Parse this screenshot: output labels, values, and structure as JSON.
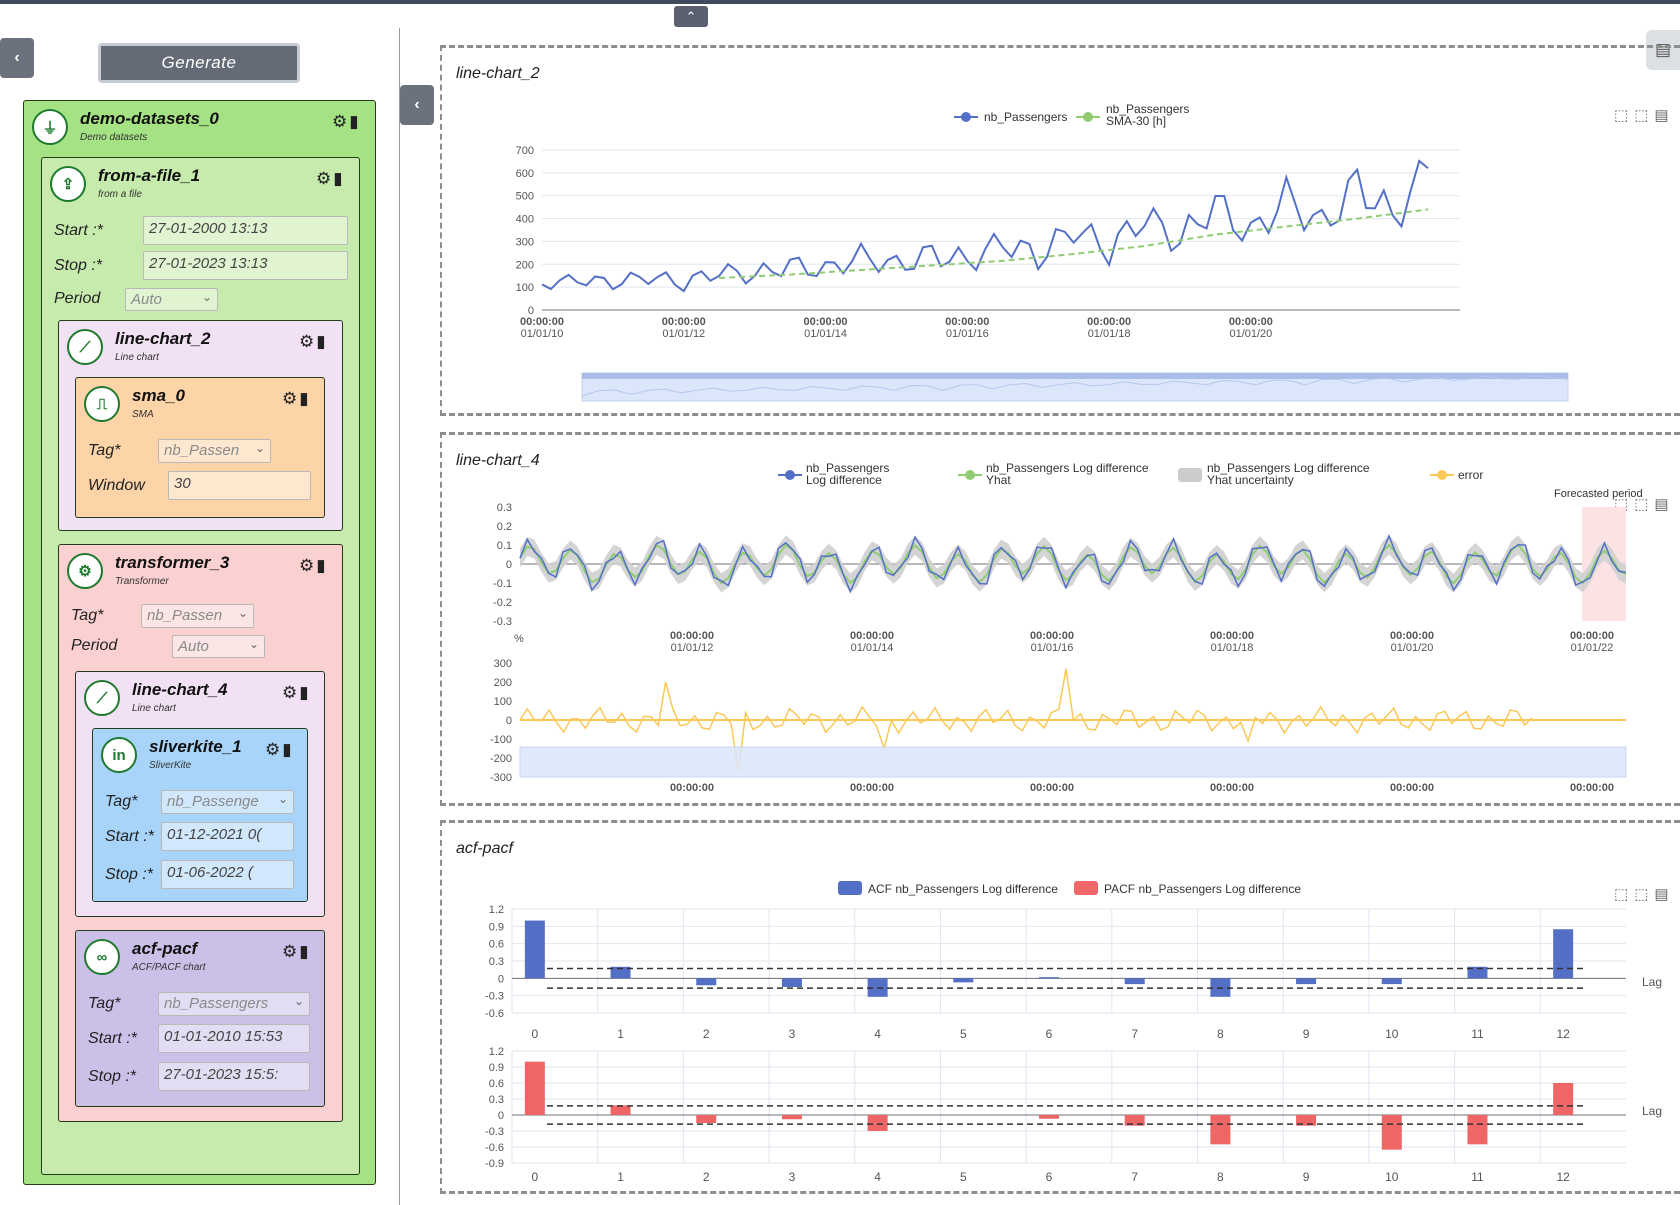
{
  "ui": {
    "generate_label": "Generate",
    "collapse_top": "⌃",
    "collapse_left": "‹",
    "collapse_mid": "‹",
    "gear": "⚙",
    "trash": "🗑"
  },
  "nodes": {
    "demo": {
      "title": "demo-datasets_0",
      "subtitle": "Demo datasets",
      "icon": "plug-icon"
    },
    "from_file": {
      "title": "from-a-file_1",
      "subtitle": "from a file",
      "icon": "upload-icon",
      "start_label": "Start :*",
      "start_value": "27-01-2000 13:13",
      "stop_label": "Stop :*",
      "stop_value": "27-01-2023 13:13",
      "period_label": "Period",
      "period_value": "Auto"
    },
    "line_chart_2": {
      "title": "line-chart_2",
      "subtitle": "Line chart",
      "icon": "line-chart-icon"
    },
    "sma": {
      "title": "sma_0",
      "subtitle": "SMA",
      "icon": "step-icon",
      "tag_label": "Tag*",
      "tag_value": "nb_Passen",
      "window_label": "Window",
      "window_value": "30"
    },
    "transformer": {
      "title": "transformer_3",
      "subtitle": "Transformer",
      "icon": "cogs-icon",
      "tag_label": "Tag*",
      "tag_value": "nb_Passen",
      "period_label": "Period",
      "period_value": "Auto"
    },
    "line_chart_4": {
      "title": "line-chart_4",
      "subtitle": "Line chart",
      "icon": "line-chart-icon"
    },
    "sliverkite": {
      "title": "sliverkite_1",
      "subtitle": "SliverKite",
      "icon": "linkedin-icon",
      "tag_label": "Tag*",
      "tag_value": "nb_Passenge",
      "start_label": "Start :*",
      "start_value": "01-12-2021 0(",
      "stop_label": "Stop :*",
      "stop_value": "01-06-2022 (",
      "icon_glyph": "in"
    },
    "acf": {
      "title": "acf-pacf",
      "subtitle": "ACF/PACF chart",
      "icon": "infinity-icon",
      "tag_label": "Tag*",
      "tag_value": "nb_Passengers",
      "start_label": "Start :*",
      "start_value": "01-01-2010 15:53",
      "stop_label": "Stop :*",
      "stop_value": "27-01-2023 15:5:"
    }
  },
  "panels": {
    "p1_title": "line-chart_2",
    "p2_title": "line-chart_4",
    "p3_title": "acf-pacf"
  },
  "chart_data": [
    {
      "type": "line",
      "title": "line-chart_2",
      "series": [
        {
          "name": "nb_Passengers",
          "color": "#5470c6",
          "x": [
            "2010-01",
            "2010-07",
            "2011-01",
            "2011-07",
            "2012-01",
            "2012-07",
            "2013-01",
            "2013-07",
            "2014-01",
            "2014-07",
            "2015-01",
            "2015-07",
            "2016-01",
            "2016-07",
            "2017-01",
            "2017-07",
            "2018-01",
            "2018-07",
            "2019-01",
            "2019-07",
            "2020-01",
            "2020-07",
            "2021-01",
            "2021-07",
            "2022-01",
            "2022-07"
          ],
          "values": [
            112,
            135,
            118,
            148,
            115,
            170,
            150,
            200,
            170,
            240,
            190,
            250,
            210,
            300,
            230,
            360,
            260,
            410,
            300,
            470,
            320,
            500,
            360,
            560,
            400,
            620
          ]
        },
        {
          "name": "nb_Passengers SMA-30 [h]",
          "color": "#91cc75",
          "x": [
            "2012-07",
            "2013-07",
            "2014-07",
            "2015-07",
            "2016-07",
            "2017-07",
            "2018-07",
            "2019-07",
            "2020-07",
            "2021-07",
            "2022-07"
          ],
          "values": [
            140,
            155,
            175,
            195,
            215,
            245,
            280,
            330,
            365,
            400,
            440
          ]
        }
      ],
      "ylim": [
        0,
        700
      ],
      "yticks": [
        "700",
        "600",
        "500",
        "400",
        "300",
        "200",
        "100",
        "0"
      ],
      "xticks": [
        [
          "00:00:00",
          "01/01/10"
        ],
        [
          "00:00:00",
          "01/01/12"
        ],
        [
          "00:00:00",
          "01/01/14"
        ],
        [
          "00:00:00",
          "01/01/16"
        ],
        [
          "00:00:00",
          "01/01/18"
        ],
        [
          "00:00:00",
          "01/01/20"
        ]
      ],
      "legend": [
        "nb_Passengers",
        "nb_Passengers",
        "SMA-30 [h]"
      ]
    },
    {
      "type": "line",
      "title": "line-chart_4",
      "series": [
        {
          "name": "nb_Passengers Log difference",
          "color": "#5470c6"
        },
        {
          "name": "nb_Passengers Log difference Yhat",
          "color": "#91cc75"
        },
        {
          "name": "nb_Passengers Log difference Yhat uncertainty",
          "color": "#cccccc"
        },
        {
          "name": "error",
          "color": "#fac858"
        }
      ],
      "ylim_top": [
        -0.3,
        0.3
      ],
      "yticks_top": [
        "0.3",
        "0.2",
        "0.1",
        "0",
        "-0.1",
        "-0.2",
        "-0.3"
      ],
      "ylim_bottom": [
        -300,
        300
      ],
      "yticks_bottom": [
        "300",
        "200",
        "100",
        "0",
        "-100",
        "-200",
        "-300"
      ],
      "bottom_unit": "%",
      "xticks": [
        [
          "00:00:00",
          "01/01/12"
        ],
        [
          "00:00:00",
          "01/01/14"
        ],
        [
          "00:00:00",
          "01/01/16"
        ],
        [
          "00:00:00",
          "01/01/18"
        ],
        [
          "00:00:00",
          "01/01/20"
        ],
        [
          "00:00:00",
          "01/01/22"
        ]
      ],
      "xticks_bottom": [
        "00:00:00",
        "00:00:00",
        "00:00:00",
        "00:00:00",
        "00:00:00",
        "00:00:00"
      ],
      "annotation": "Forecasted period",
      "legend": [
        "nb_Passengers",
        "Log difference",
        "nb_Passengers Log difference",
        "Yhat",
        "nb_Passengers Log difference",
        "Yhat uncertainty",
        "error"
      ]
    },
    {
      "type": "bar",
      "title": "acf-pacf",
      "categories": [
        "0",
        "1",
        "2",
        "3",
        "4",
        "5",
        "6",
        "7",
        "8",
        "9",
        "10",
        "11",
        "12"
      ],
      "series": [
        {
          "name": "ACF nb_Passengers Log difference",
          "color": "#5470c6",
          "values": [
            1.0,
            0.2,
            -0.12,
            -0.15,
            -0.32,
            -0.07,
            0.02,
            -0.1,
            -0.32,
            -0.1,
            -0.1,
            0.2,
            0.85
          ]
        },
        {
          "name": "PACF nb_Passengers Log difference",
          "color": "#ee6666",
          "values": [
            1.0,
            0.18,
            -0.15,
            -0.08,
            -0.3,
            0.0,
            -0.07,
            -0.2,
            -0.55,
            -0.2,
            -0.65,
            -0.55,
            0.6
          ]
        }
      ],
      "ylim_acf": [
        -0.6,
        1.2
      ],
      "yticks_acf": [
        "1.2",
        "0.9",
        "0.6",
        "0.3",
        "0",
        "-0.3",
        "-0.6"
      ],
      "ylim_pacf": [
        -0.9,
        1.2
      ],
      "yticks_pacf": [
        "1.2",
        "0.9",
        "0.6",
        "0.3",
        "0",
        "-0.3",
        "-0.6",
        "-0.9"
      ],
      "confidence": [
        0.17,
        -0.17
      ],
      "xlabel": "Lag"
    }
  ]
}
